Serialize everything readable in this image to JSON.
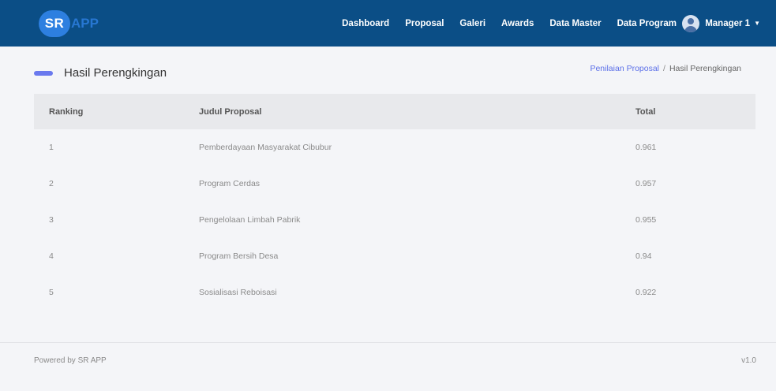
{
  "app": {
    "logo_badge": "SR",
    "logo_text": "APP"
  },
  "nav": {
    "items": [
      {
        "label": "Dashboard"
      },
      {
        "label": "Proposal"
      },
      {
        "label": "Galeri"
      },
      {
        "label": "Awards"
      },
      {
        "label": "Data Master"
      },
      {
        "label": "Data Program"
      }
    ],
    "user_name": "Manager 1",
    "caret": "▼"
  },
  "page": {
    "title": "Hasil Perengkingan",
    "breadcrumb": {
      "link": "Penilaian Proposal",
      "separator": "/",
      "current": "Hasil Perengkingan"
    }
  },
  "table": {
    "headers": [
      "Ranking",
      "Judul Proposal",
      "Total"
    ],
    "rows": [
      {
        "rank": "1",
        "title": "Pemberdayaan Masyarakat Cibubur",
        "total": "0.961"
      },
      {
        "rank": "2",
        "title": "Program Cerdas",
        "total": "0.957"
      },
      {
        "rank": "3",
        "title": "Pengelolaan Limbah Pabrik",
        "total": "0.955"
      },
      {
        "rank": "4",
        "title": "Program Bersih Desa",
        "total": "0.94"
      },
      {
        "rank": "5",
        "title": "Sosialisasi Reboisasi",
        "total": "0.922"
      }
    ]
  },
  "footer": {
    "powered_by": "Powered by SR APP",
    "version": "v1.0"
  },
  "colors": {
    "navbar": "#0b4e86",
    "accent": "#6a79ee",
    "link": "#5b6fe8",
    "logo": "#2d7fe0"
  }
}
